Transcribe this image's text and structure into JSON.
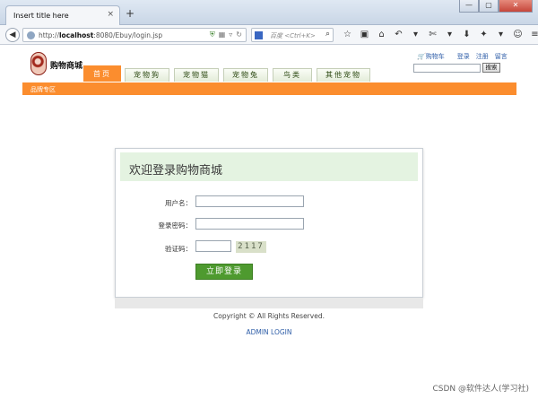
{
  "browser": {
    "tab_title": "Insert title here",
    "tab_close": "×",
    "new_tab": "+",
    "window_controls": [
      "—",
      "▢",
      "✕"
    ],
    "url_prefix": "http://",
    "url_host": "localhost",
    "url_rest": ":8080/Ebuy/login.jsp",
    "search_placeholder": "百度 <Ctrl+K>",
    "toolbar_icons": [
      "☆",
      "▣",
      "⌂",
      "↶",
      "▾",
      "✄",
      "▾",
      "⬇",
      "✦",
      "▾",
      "☺",
      "≡"
    ]
  },
  "header": {
    "logo_text": "购物商城",
    "menu": [
      {
        "label": "首页",
        "active": true
      },
      {
        "label": "宠物狗",
        "active": false
      },
      {
        "label": "宠物猫",
        "active": false
      },
      {
        "label": "宠物兔",
        "active": false
      },
      {
        "label": "鸟类",
        "active": false
      },
      {
        "label": "其他宠物",
        "active": false
      }
    ],
    "links": {
      "cart": "购物车",
      "login": "登录",
      "register": "注册",
      "message": "留言"
    },
    "search_button": "搜索",
    "brand_zone": "品牌专区"
  },
  "login": {
    "title": "欢迎登录购物商城",
    "username_label": "用户名：",
    "username_value": "",
    "password_label": "登录密码：",
    "password_value": "",
    "captcha_label": "验证码：",
    "captcha_value": "",
    "captcha_image_text": "2117",
    "submit_label": "立即登录"
  },
  "footer": {
    "copyright": "Copyright © All Rights Reserved.",
    "admin_login": "ADMIN LOGIN"
  },
  "watermark": "CSDN @软件达人(学习社)"
}
